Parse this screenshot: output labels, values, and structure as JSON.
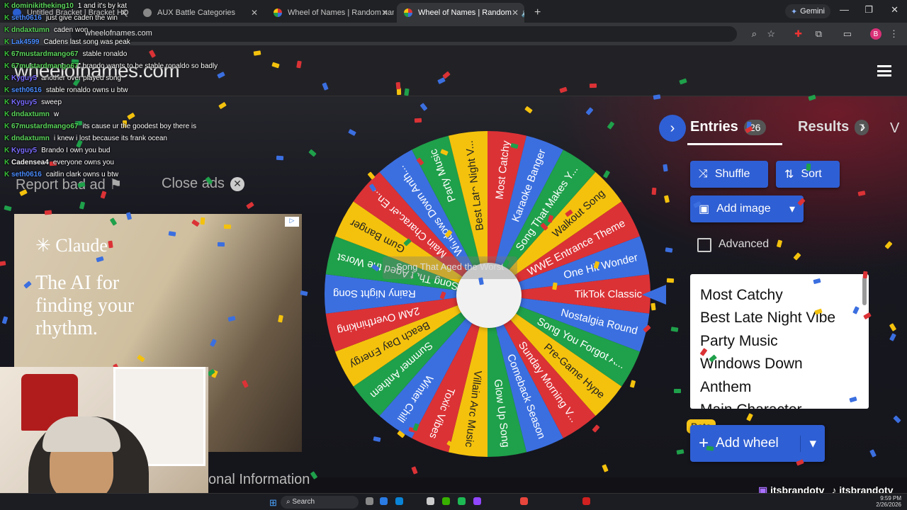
{
  "browser": {
    "tabs": [
      {
        "label": "Untitled Bracket | Bracket HQ",
        "active": false
      },
      {
        "label": "AUX Battle Categories",
        "active": false
      },
      {
        "label": "Wheel of Names | Random nam",
        "active": false
      },
      {
        "label": "Wheel of Names | Random",
        "active": true
      }
    ],
    "gemini_label": "Gemini",
    "url": "wheelofnames.com",
    "avatar_letter": "B"
  },
  "site": {
    "logo": "wheelofnames.com",
    "report_bad_ad": "Report bad ad",
    "close_ads": "Close ads",
    "ad": {
      "brand": "Claude",
      "tagline": "The AI for finding your rhythm."
    },
    "personal_info": "onal Information"
  },
  "chat": [
    {
      "user": "dominikitheking10",
      "msg": "1 and it's by kat",
      "color": "#5bd65b"
    },
    {
      "user": "seth0616",
      "msg": "just give caden the win",
      "color": "#4a8cff"
    },
    {
      "user": "dndaxtumn",
      "msg": "caden won",
      "color": "#5bd65b"
    },
    {
      "user": "Lak4599",
      "msg": "Cadens last song was peak",
      "color": "#4a8cff"
    },
    {
      "user": "67mustardmango67",
      "msg": "stable ronaldo",
      "color": "#5bd65b"
    },
    {
      "user": "67mustardmango67",
      "msg": "brando wants to be stable ronaldo so badly",
      "color": "#5bd65b"
    },
    {
      "user": "Kyguy5",
      "msg": "another over played song",
      "color": "#7a6cff"
    },
    {
      "user": "seth0616",
      "msg": "stable ronaldo owns u btw",
      "color": "#4a8cff"
    },
    {
      "user": "Kyguy5",
      "msg": "sweep",
      "color": "#7a6cff"
    },
    {
      "user": "dndaxtumn",
      "msg": "w",
      "color": "#5bd65b"
    },
    {
      "user": "67mustardmango67",
      "msg": "its cause ur the goodest boy there is",
      "color": "#5bd65b"
    },
    {
      "user": "dndaxtumn",
      "msg": "i knew i lost because its frank ocean",
      "color": "#5bd65b"
    },
    {
      "user": "Kyguy5",
      "msg": "Brando I own you bud",
      "color": "#7a6cff"
    },
    {
      "user": "Cadensea4",
      "msg": "everyone owns you",
      "color": "#f2f2f2"
    },
    {
      "user": "seth0616",
      "msg": "caitlin clark owns u btw",
      "color": "#4a8cff"
    }
  ],
  "wheel": {
    "overlay_text": "Song That Aged the Worst",
    "colors": [
      "#db3236",
      "#3b6fe0",
      "#1fa04a",
      "#f4c20d"
    ],
    "segments": [
      "TikTok Classic",
      "Nostalgia Round",
      "Song You Forgot A...",
      "Pre-Game Hype",
      "Sunday Morning V...",
      "Comeback Season",
      "Glow Up Song",
      "Villain Arc Music",
      "Toxic Vibes",
      "Winter Chill",
      "Summer Anthem",
      "Beach Day Energy",
      "2AM Overthinking",
      "Rainy Night Song",
      "Song That Aged the Worst",
      "Gum Banger",
      "Main Character En...",
      "Windows Down Anth...",
      "Party Music",
      "Best Late Night V...",
      "Most Catchy",
      "Karaoke Banger",
      "Song That Makes Y...",
      "Walkout Song",
      "WWE Entrance Theme",
      "One Hit Wonder"
    ]
  },
  "panel": {
    "entries_label": "Entries",
    "entries_count": "26",
    "results_label": "Results",
    "results_count": "7",
    "next_tab_partial": "V",
    "shuffle": "Shuffle",
    "sort": "Sort",
    "add_image": "Add image",
    "advanced": "Advanced",
    "entries": [
      "Most Catchy",
      "Best Late Night Vibe",
      "Party Music",
      "Windows Down",
      "Anthem",
      "Main Character"
    ],
    "beta": "Beta",
    "add_wheel": "Add wheel"
  },
  "stream": {
    "handles": [
      "itsbrandotv",
      "itsbrandotv"
    ]
  },
  "taskbar": {
    "search": "Search",
    "time": "9:59 PM",
    "date": "2/26/2026"
  }
}
